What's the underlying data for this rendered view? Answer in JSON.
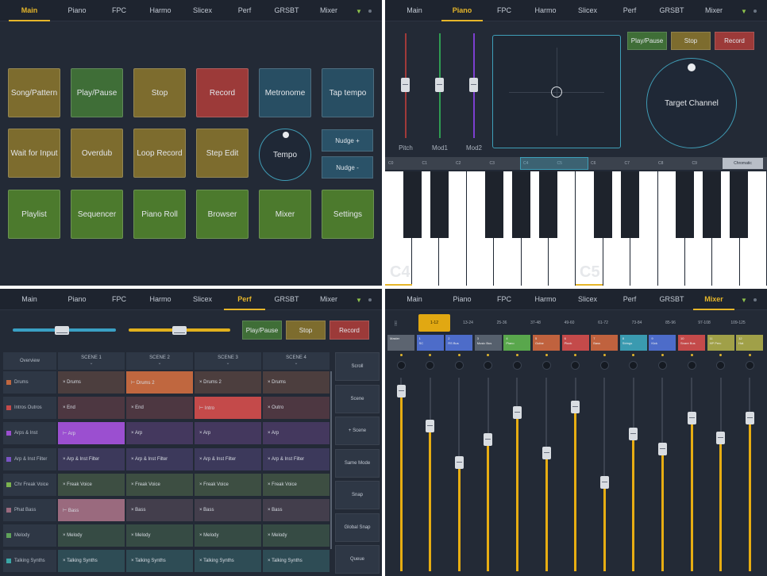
{
  "tabs": [
    "Main",
    "Piano",
    "FPC",
    "Harmo",
    "Slicex",
    "Perf",
    "GRSBT",
    "Mixer"
  ],
  "main": {
    "active_tab": "Main",
    "pads": [
      {
        "label": "Song/Pattern",
        "color": "olive"
      },
      {
        "label": "Play/Pause",
        "color": "green"
      },
      {
        "label": "Stop",
        "color": "olive"
      },
      {
        "label": "Record",
        "color": "red"
      },
      {
        "label": "Metronome",
        "color": "teal"
      },
      {
        "label": "Tap tempo",
        "color": "teal"
      },
      {
        "label": "Wait for Input",
        "color": "olive"
      },
      {
        "label": "Overdub",
        "color": "olive"
      },
      {
        "label": "Loop Record",
        "color": "olive"
      },
      {
        "label": "Step Edit",
        "color": "olive"
      },
      {
        "label": "Playlist",
        "color": "lgreen"
      },
      {
        "label": "Sequencer",
        "color": "lgreen"
      },
      {
        "label": "Piano Roll",
        "color": "lgreen"
      },
      {
        "label": "Browser",
        "color": "lgreen"
      },
      {
        "label": "Mixer",
        "color": "lgreen"
      },
      {
        "label": "Settings",
        "color": "lgreen"
      }
    ],
    "tempo_label": "Tempo",
    "nudge_plus": "Nudge +",
    "nudge_minus": "Nudge -"
  },
  "piano": {
    "active_tab": "Piano",
    "sliders": [
      "Pitch",
      "Mod1",
      "Mod2"
    ],
    "play_pause": "Play/Pause",
    "stop": "Stop",
    "record": "Record",
    "target_channel": "Target Channel",
    "key_labels": [
      "C0",
      "C1",
      "C2",
      "C3",
      "C4",
      "C5",
      "C6",
      "C7",
      "C8",
      "C9"
    ],
    "chromatic": "Chromatic",
    "octave_labels": [
      "C4",
      "C5"
    ]
  },
  "perf": {
    "active_tab": "Perf",
    "play_pause": "Play/Pause",
    "stop": "Stop",
    "record": "Record",
    "overview": "Overview",
    "scenes": [
      "SCENE 1",
      "SCENE 2",
      "SCENE 3",
      "SCENE 4"
    ],
    "rows": [
      {
        "name": "Drums",
        "color": "#c0673f",
        "cells": [
          "× Drums",
          "⊢ Drums 2",
          "× Drums 2",
          "× Drums"
        ]
      },
      {
        "name": "Intros Outros",
        "color": "#c44a4a",
        "cells": [
          "× End",
          "× End",
          "⊢ Intro",
          "× Outro"
        ]
      },
      {
        "name": "Arps & Inst",
        "color": "#9b4fd0",
        "cells": [
          "⊢ Arp",
          "× Arp",
          "× Arp",
          "× Arp"
        ]
      },
      {
        "name": "Arp & Inst Filter",
        "color": "#7a54c4",
        "cells": [
          "× Arp & Inst Filter",
          "× Arp & Inst Filter",
          "× Arp & Inst Filter",
          "× Arp & Inst Filter"
        ]
      },
      {
        "name": "Chr Freak Voice",
        "color": "#7bb24f",
        "cells": [
          "× Freak Voice",
          "× Freak Voice",
          "× Freak Voice",
          "× Freak Voice"
        ]
      },
      {
        "name": "Phat Bass",
        "color": "#9a6a7e",
        "cells": [
          "⊢ Bass",
          "× Bass",
          "× Bass",
          "× Bass"
        ]
      },
      {
        "name": "Melody",
        "color": "#5fa25a",
        "cells": [
          "× Melody",
          "× Melody",
          "× Melody",
          "× Melody"
        ]
      },
      {
        "name": "Talking Synths",
        "color": "#3aa6a6",
        "cells": [
          "× Talking Synths",
          "× Talking Synths",
          "× Talking Synths",
          "× Talking Synths"
        ]
      }
    ],
    "right_buttons": [
      "Scroll",
      "Scene",
      "+ Scene",
      "Same Mode",
      "Snap",
      "Global Snap",
      "Queue"
    ]
  },
  "mixer": {
    "active_tab": "Mixer",
    "banks": [
      "1-12",
      "13-24",
      "25-36",
      "37-48",
      "49-60",
      "61-72",
      "73-84",
      "85-96",
      "97-108",
      "109-125"
    ],
    "channels": [
      {
        "num": "",
        "name": "Master",
        "color": "#5c6470",
        "level": 0.93
      },
      {
        "num": "1",
        "name": "SC",
        "color": "#4d6cc9",
        "level": 0.75
      },
      {
        "num": "2",
        "name": "RS Bus",
        "color": "#4d6cc9",
        "level": 0.56
      },
      {
        "num": "3",
        "name": "Music Bus",
        "color": "#56606d",
        "level": 0.68
      },
      {
        "num": "4",
        "name": "Piano",
        "color": "#59a74c",
        "level": 0.82
      },
      {
        "num": "5",
        "name": "Guitar",
        "color": "#c0623e",
        "level": 0.61
      },
      {
        "num": "6",
        "name": "Pluck",
        "color": "#c44a4a",
        "level": 0.85
      },
      {
        "num": "7",
        "name": "Bass",
        "color": "#c0623e",
        "level": 0.46
      },
      {
        "num": "8",
        "name": "Strings",
        "color": "#3a9ab0",
        "level": 0.71
      },
      {
        "num": "9",
        "name": "Kick",
        "color": "#4d6cc9",
        "level": 0.63
      },
      {
        "num": "10",
        "name": "Snare Bus",
        "color": "#c44a4a",
        "level": 0.79
      },
      {
        "num": "11",
        "name": "HP Perc",
        "color": "#a0a048",
        "level": 0.69
      },
      {
        "num": "12",
        "name": "Hat",
        "color": "#a0a048",
        "level": 0.79
      }
    ]
  }
}
